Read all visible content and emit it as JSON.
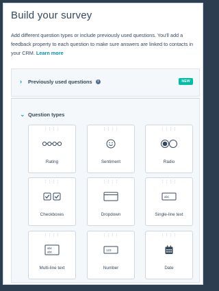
{
  "header": {
    "title": "Build your survey",
    "description": "Add different question types or include previously used questions. You'll add a feedback property to each question to make sure answers are linked to contacts in your CRM.",
    "learn_more": "Learn more"
  },
  "previous": {
    "label": "Previously used questions",
    "info_icon": "info-circle-icon",
    "badge": "NEW",
    "chevron": "chevron-right-icon"
  },
  "question_types": {
    "label": "Question types",
    "chevron": "chevron-down-icon",
    "items": [
      {
        "label": "Rating",
        "icon": "rating-icon"
      },
      {
        "label": "Sentiment",
        "icon": "smiley-icon"
      },
      {
        "label": "Radio",
        "icon": "radio-icon"
      },
      {
        "label": "Checkboxes",
        "icon": "checkbox-icon"
      },
      {
        "label": "Dropdown",
        "icon": "dropdown-icon"
      },
      {
        "label": "Single-line text",
        "icon": "single-line-text-icon"
      },
      {
        "label": "Multi-line text",
        "icon": "multi-line-text-icon"
      },
      {
        "label": "Number",
        "icon": "number-icon"
      },
      {
        "label": "Date",
        "icon": "calendar-icon"
      }
    ],
    "number_sample": "123",
    "text_sample": "abc"
  },
  "colors": {
    "background": "#2d3e50",
    "text": "#33475b",
    "link": "#0091ae",
    "badge": "#00bda5"
  }
}
